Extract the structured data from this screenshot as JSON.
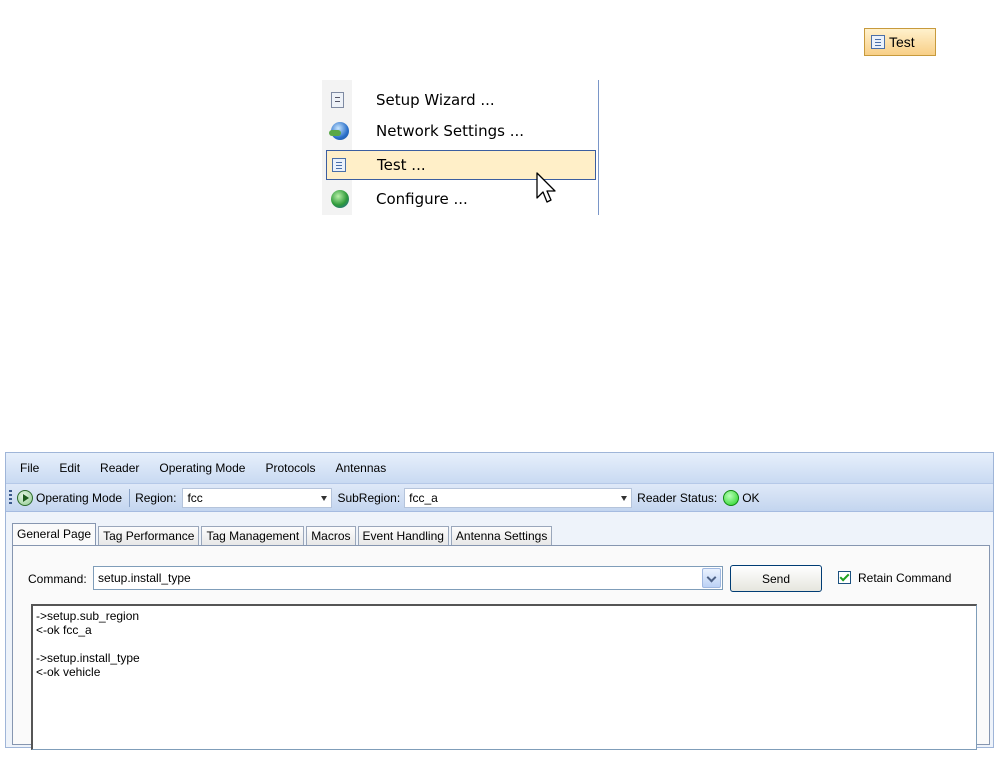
{
  "top_button": {
    "label": "Test"
  },
  "context_menu": {
    "items": [
      {
        "label": "Setup Wizard ...",
        "icon": "setup-icon"
      },
      {
        "label": "Network Settings ...",
        "icon": "network-icon"
      },
      {
        "label": "Test ...",
        "icon": "test-icon",
        "active": true
      },
      {
        "label": "Configure ...",
        "icon": "globe-icon"
      }
    ]
  },
  "app": {
    "menu": [
      "File",
      "Edit",
      "Reader",
      "Operating Mode",
      "Protocols",
      "Antennas"
    ],
    "toolbar": {
      "operating_mode": "Operating Mode",
      "region_label": "Region:",
      "region_value": "fcc",
      "subregion_label": "SubRegion:",
      "subregion_value": "fcc_a",
      "status_label": "Reader Status:",
      "status_value": "OK",
      "status_color": "#1fd21f"
    },
    "tabs": [
      "General Page",
      "Tag Performance",
      "Tag Management",
      "Macros",
      "Event Handling",
      "Antenna Settings"
    ],
    "general": {
      "command_label": "Command:",
      "command_value": "setup.install_type",
      "send_label": "Send",
      "retain_label": "Retain Command",
      "retain_checked": true,
      "output": "->setup.sub_region\n<-ok fcc_a\n\n->setup.install_type\n<-ok vehicle"
    }
  }
}
